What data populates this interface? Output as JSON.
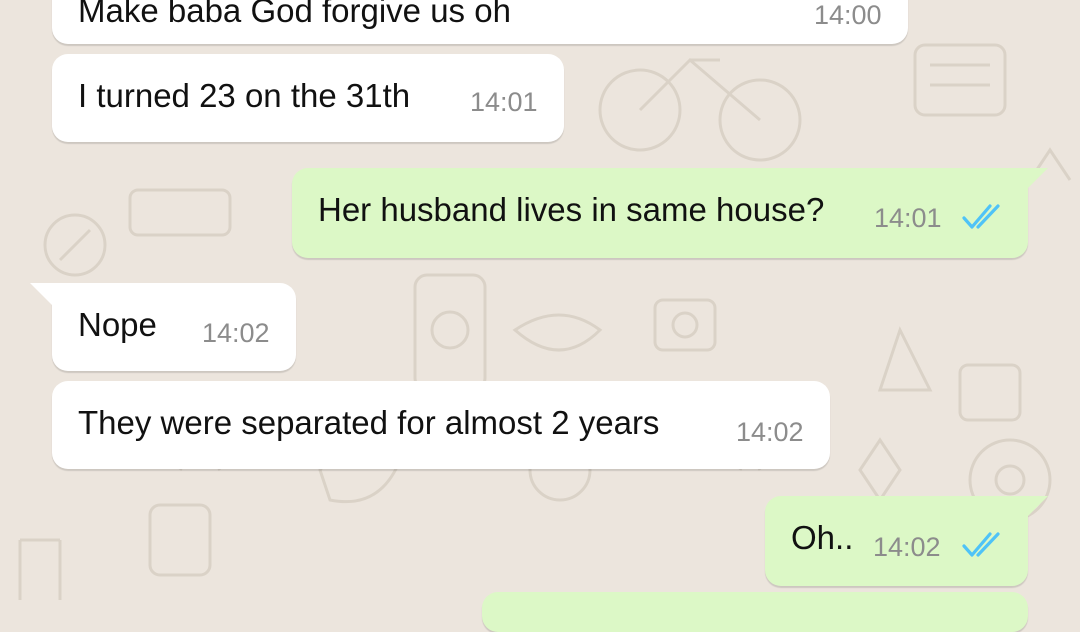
{
  "chat": {
    "messages": [
      {
        "direction": "incoming",
        "text": "Make baba God forgive us oh",
        "time": "14:00"
      },
      {
        "direction": "incoming",
        "text": "I turned 23 on the 31th",
        "time": "14:01"
      },
      {
        "direction": "outgoing",
        "text": "Her husband lives in same house?",
        "time": "14:01",
        "status": "read"
      },
      {
        "direction": "incoming",
        "text": "Nope",
        "time": "14:02"
      },
      {
        "direction": "incoming",
        "text": "They were separated for almost 2 years",
        "time": "14:02"
      },
      {
        "direction": "outgoing",
        "text": "Oh..",
        "time": "14:02",
        "status": "read"
      }
    ]
  },
  "colors": {
    "background": "#ECE5DD",
    "incoming_bubble": "#FFFFFF",
    "outgoing_bubble": "#DCF8C6",
    "read_tick": "#4FC3F7"
  },
  "icons": {
    "read_receipt": "double-check-icon"
  }
}
